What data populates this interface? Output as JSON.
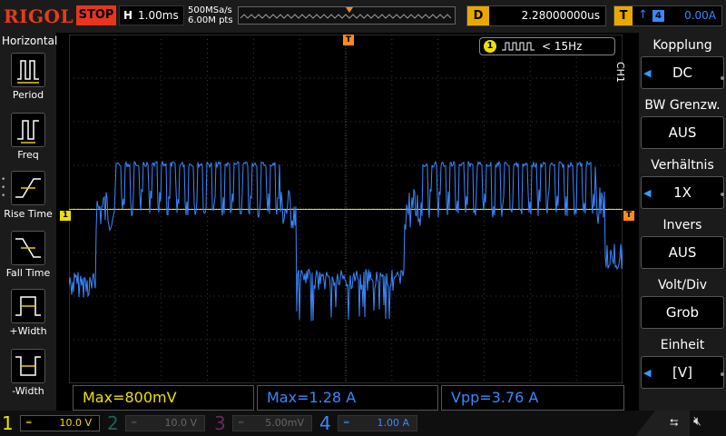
{
  "brand": "RIGOL",
  "run_state": "STOP",
  "timebase": {
    "label": "H",
    "value": "1.00ms"
  },
  "sample_rate": {
    "rate": "500MSa/s",
    "points": "6.00M pts"
  },
  "delay": {
    "label": "D",
    "value": "2.28000000us"
  },
  "trigger": {
    "label": "T",
    "edge_icon": "rising-edge-icon",
    "source": "4",
    "level": "0.00A"
  },
  "left_menu": {
    "title": "Horizontal",
    "items": [
      {
        "label": "Period"
      },
      {
        "label": "Freq"
      },
      {
        "label": "Rise Time"
      },
      {
        "label": "Fall Time"
      },
      {
        "label": "+Width"
      },
      {
        "label": "-Width"
      }
    ]
  },
  "frequency_readout": {
    "channel": "1",
    "value": "< 15Hz"
  },
  "channel_tag": "CH1",
  "right_menu": [
    {
      "title": "Kopplung",
      "value": "DC"
    },
    {
      "title": "BW Grenzw.",
      "value": "AUS"
    },
    {
      "title": "Verhältnis",
      "value": "1X"
    },
    {
      "title": "Invers",
      "value": "AUS"
    },
    {
      "title": "Volt/Div",
      "value": "Grob"
    },
    {
      "title": "Einheit",
      "value": "[V]"
    }
  ],
  "measurements": [
    {
      "text": "Max=800mV",
      "color": "#f0e000"
    },
    {
      "text": "Max=1.28 A",
      "color": "#3a88ff"
    },
    {
      "text": "Vpp=3.76 A",
      "color": "#3a88ff"
    }
  ],
  "channels": [
    {
      "num": "1",
      "scale": "10.0 V",
      "color": "#f0e000",
      "active": true
    },
    {
      "num": "2",
      "scale": "10.0 V",
      "color": "#2aa890",
      "active": false
    },
    {
      "num": "3",
      "scale": "5.00mV",
      "color": "#b040a0",
      "active": false
    },
    {
      "num": "4",
      "scale": "1.00 A",
      "color": "#3a88ff",
      "active": true
    }
  ],
  "markers": {
    "ch1_level": "1",
    "trigger_position": "T"
  },
  "colors": {
    "ch1": "#f0e000",
    "ch4": "#3a88ff",
    "trigger": "#ff8a1c",
    "brand": "#e83a1c"
  }
}
